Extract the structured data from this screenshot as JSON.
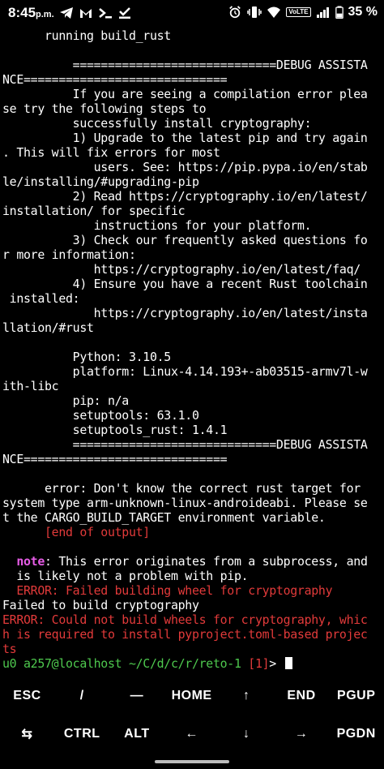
{
  "status_bar": {
    "time": "8:45",
    "ampm": "p.m.",
    "volte": "VoLTE",
    "battery": "35 %",
    "left_icons": [
      "telegram-icon",
      "gmail-icon",
      "terminal-icon",
      "download-done-icon"
    ],
    "right_icons": [
      "alarm-icon",
      "vibrate-icon",
      "wifi-icon",
      "signal-icon",
      "battery-icon"
    ]
  },
  "terminal": {
    "lines": [
      {
        "text": "      running build_rust",
        "color": "white"
      },
      {
        "text": "",
        "color": "white"
      },
      {
        "text": "          =============================DEBUG ASSISTA",
        "color": "white"
      },
      {
        "text": "NCE=============================",
        "color": "white"
      },
      {
        "text": "          If you are seeing a compilation error plea",
        "color": "white"
      },
      {
        "text": "se try the following steps to",
        "color": "white"
      },
      {
        "text": "          successfully install cryptography:",
        "color": "white"
      },
      {
        "text": "          1) Upgrade to the latest pip and try again",
        "color": "white"
      },
      {
        "text": ". This will fix errors for most",
        "color": "white"
      },
      {
        "text": "             users. See: https://pip.pypa.io/en/stab",
        "color": "white"
      },
      {
        "text": "le/installing/#upgrading-pip",
        "color": "white"
      },
      {
        "text": "          2) Read https://cryptography.io/en/latest/",
        "color": "white"
      },
      {
        "text": "installation/ for specific",
        "color": "white"
      },
      {
        "text": "             instructions for your platform.",
        "color": "white"
      },
      {
        "text": "          3) Check our frequently asked questions fo",
        "color": "white"
      },
      {
        "text": "r more information:",
        "color": "white"
      },
      {
        "text": "             https://cryptography.io/en/latest/faq/",
        "color": "white"
      },
      {
        "text": "          4) Ensure you have a recent Rust toolchain",
        "color": "white"
      },
      {
        "text": " installed:",
        "color": "white"
      },
      {
        "text": "             https://cryptography.io/en/latest/insta",
        "color": "white"
      },
      {
        "text": "llation/#rust",
        "color": "white"
      },
      {
        "text": "",
        "color": "white"
      },
      {
        "text": "          Python: 3.10.5",
        "color": "white"
      },
      {
        "text": "          platform: Linux-4.14.193+-ab03515-armv7l-w",
        "color": "white"
      },
      {
        "text": "ith-libc",
        "color": "white"
      },
      {
        "text": "          pip: n/a",
        "color": "white"
      },
      {
        "text": "          setuptools: 63.1.0",
        "color": "white"
      },
      {
        "text": "          setuptools_rust: 1.4.1",
        "color": "white"
      },
      {
        "text": "          =============================DEBUG ASSISTA",
        "color": "white"
      },
      {
        "text": "NCE=============================",
        "color": "white"
      },
      {
        "text": "",
        "color": "white"
      },
      {
        "text": "      error: Don't know the correct rust target for",
        "color": "white"
      },
      {
        "text": "system type arm-unknown-linux-androideabi. Please se",
        "color": "white"
      },
      {
        "text": "t the CARGO_BUILD_TARGET environment variable.",
        "color": "white"
      },
      {
        "text": "      [end of output]",
        "color": "red"
      },
      {
        "text": "",
        "color": "white"
      },
      {
        "text": "note",
        "color": "note"
      },
      {
        "text": "  is likely not a problem with pip.",
        "color": "white"
      },
      {
        "text": "  ERROR: Failed building wheel for cryptography",
        "color": "red"
      },
      {
        "text": "Failed to build cryptography",
        "color": "white"
      },
      {
        "text": "ERROR: Could not build wheels for cryptography, whic",
        "color": "red"
      },
      {
        "text": "h is required to install pyproject.toml-based projec",
        "color": "red"
      },
      {
        "text": "ts",
        "color": "red"
      }
    ],
    "note_line": {
      "prefix": "  ",
      "keyword": "note",
      "rest": ": This error originates from a subprocess, and"
    },
    "prompt": {
      "user_host": "u0_a257@localhost",
      "path": " ~/C/d/c/r/reto-1",
      "exit_code": " [1]",
      "symbol": "> "
    }
  },
  "extra_keys": {
    "row1": [
      "ESC",
      "/",
      "—",
      "HOME",
      "↑",
      "END",
      "PGUP"
    ],
    "row2": [
      "⇆",
      "CTRL",
      "ALT",
      "←",
      "↓",
      "→",
      "PGDN"
    ]
  },
  "colors": {
    "background": "#000000",
    "text": "#ffffff",
    "error_red": "#e23a3a",
    "note_magenta": "#e65ce6",
    "prompt_green": "#4ec94e"
  }
}
